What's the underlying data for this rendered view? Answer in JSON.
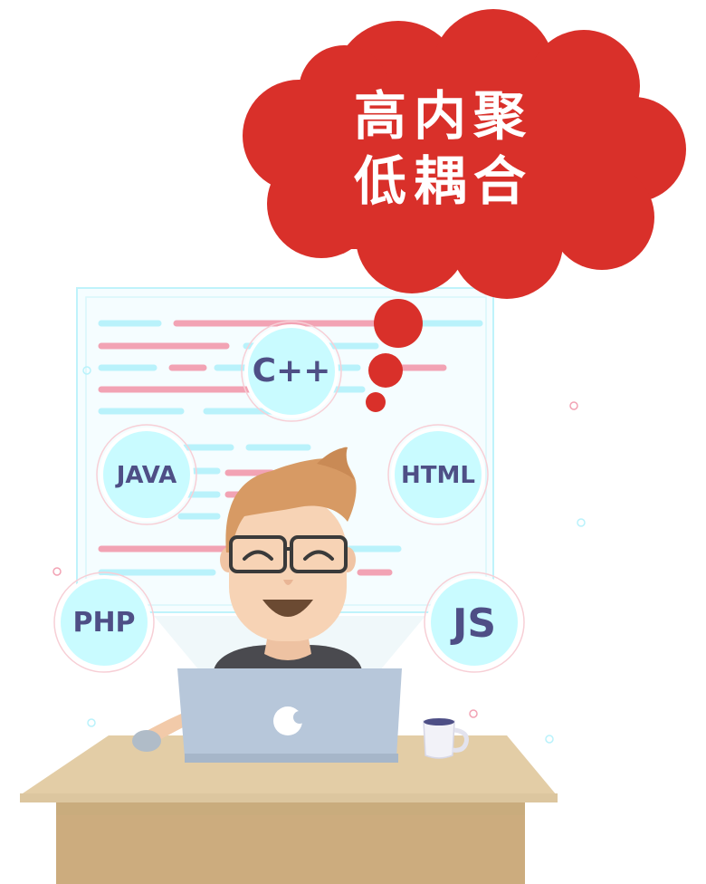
{
  "thought_bubble": {
    "line1": "高内聚",
    "line2": "低耦合"
  },
  "languages": {
    "cpp": "C++",
    "java": "JAVA",
    "html": "HTML",
    "php": "PHP",
    "js": "JS"
  },
  "colors": {
    "bubble_red": "#d9302a",
    "code_cyan": "#b9f2fb",
    "code_pink": "#f2a3b4",
    "badge_fill": "#c9fbff",
    "badge_text": "#4e4f86",
    "desk_top": "#e3cda6",
    "desk_front": "#c9ac7d",
    "laptop": "#b7c7da",
    "hair": "#d79a64",
    "skin": "#f7d3b5"
  }
}
